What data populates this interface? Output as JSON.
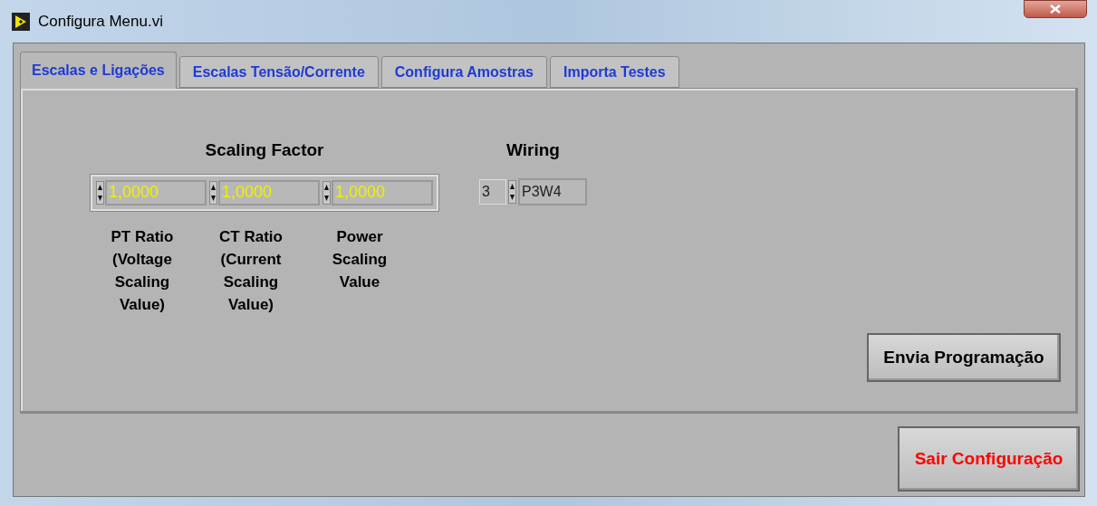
{
  "window": {
    "title": "Configura Menu.vi"
  },
  "tabs": [
    {
      "label": "Escalas e Ligações",
      "selected": true
    },
    {
      "label": "Escalas Tensão/Corrente",
      "selected": false
    },
    {
      "label": "Configura Amostras",
      "selected": false
    },
    {
      "label": "Importa Testes",
      "selected": false
    }
  ],
  "scaling_factor": {
    "title": "Scaling Factor",
    "fields": [
      {
        "value": "1,0000",
        "label": "PT Ratio (Voltage Scaling Value)"
      },
      {
        "value": "1,0000",
        "label": "CT Ratio (Current Scaling Value)"
      },
      {
        "value": "1,0000",
        "label": "Power Scaling Value"
      }
    ]
  },
  "wiring": {
    "title": "Wiring",
    "index": "3",
    "value": "P3W4"
  },
  "send_button": "Envia Programação",
  "exit_button": "Sair Configuração"
}
